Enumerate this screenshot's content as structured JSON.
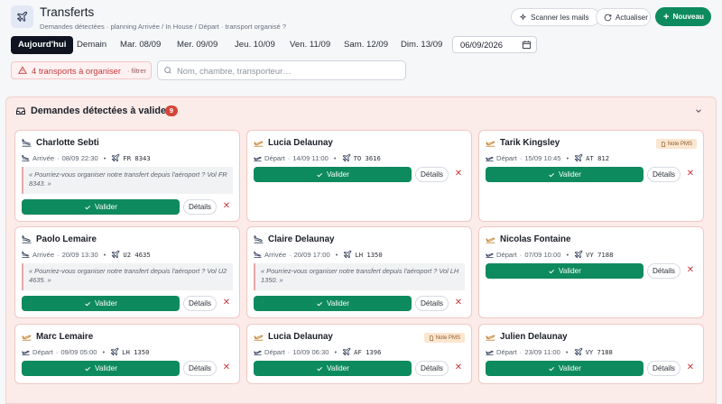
{
  "header": {
    "title": "Transferts",
    "subtitle": "Demandes détectées · planning Arrivée / In House / Départ · transport organisé ?",
    "scan_label": "Scanner les mails",
    "update_label": "Actualiser",
    "new_label": "Nouveau"
  },
  "tabs": [
    "Aujourd'hui",
    "Demain",
    "Mar. 08/09",
    "Mer. 09/09",
    "Jeu. 10/09",
    "Ven. 11/09",
    "Sam. 12/09",
    "Dim. 13/09"
  ],
  "date_value": "06/09/2026",
  "alert": {
    "label": "4 transports à organiser",
    "filter": "· filtrer"
  },
  "search": {
    "placeholder": "Nom, chambre, transporteur…",
    "value": ""
  },
  "section": {
    "title": "Demandes détectées à valider",
    "count": "9"
  },
  "card_labels": {
    "validate": "Valider",
    "details": "Détails",
    "pms": "Note PMS"
  },
  "cards": [
    {
      "name": "Charlotte Sebti",
      "type": "Arrivée",
      "time": "08/09 22:30",
      "flight": "FR 8343",
      "quote": "« Pourriez-vous organiser notre transfert depuis l'aéroport ? Vol FR 8343. »"
    },
    {
      "name": "Lucia Delaunay",
      "type": "Départ",
      "time": "14/09 11:00",
      "flight": "TO 3616"
    },
    {
      "name": "Tarik Kingsley",
      "type": "Départ",
      "time": "15/09 10:45",
      "flight": "AT 812",
      "pms": true
    },
    {
      "name": "Paolo Lemaire",
      "type": "Arrivée",
      "time": "20/09 13:30",
      "flight": "U2 4635",
      "quote": "« Pourriez-vous organiser notre transfert depuis l'aéroport ? Vol U2 4635. »"
    },
    {
      "name": "Claire Delaunay",
      "type": "Arrivée",
      "time": "20/09 17:00",
      "flight": "LH 1350",
      "quote": "« Pourriez-vous organiser notre transfert depuis l'aéroport ? Vol LH 1350. »"
    },
    {
      "name": "Nicolas Fontaine",
      "type": "Départ",
      "time": "07/09 10:00",
      "flight": "VY 7188"
    },
    {
      "name": "Marc Lemaire",
      "type": "Départ",
      "time": "09/09 05:00",
      "flight": "LH 1350"
    },
    {
      "name": "Lucia Delaunay",
      "type": "Départ",
      "time": "10/09 06:30",
      "flight": "AF 1396",
      "pms": true
    },
    {
      "name": "Julien Delaunay",
      "type": "Départ",
      "time": "23/09 11:00",
      "flight": "VY 7188"
    }
  ]
}
